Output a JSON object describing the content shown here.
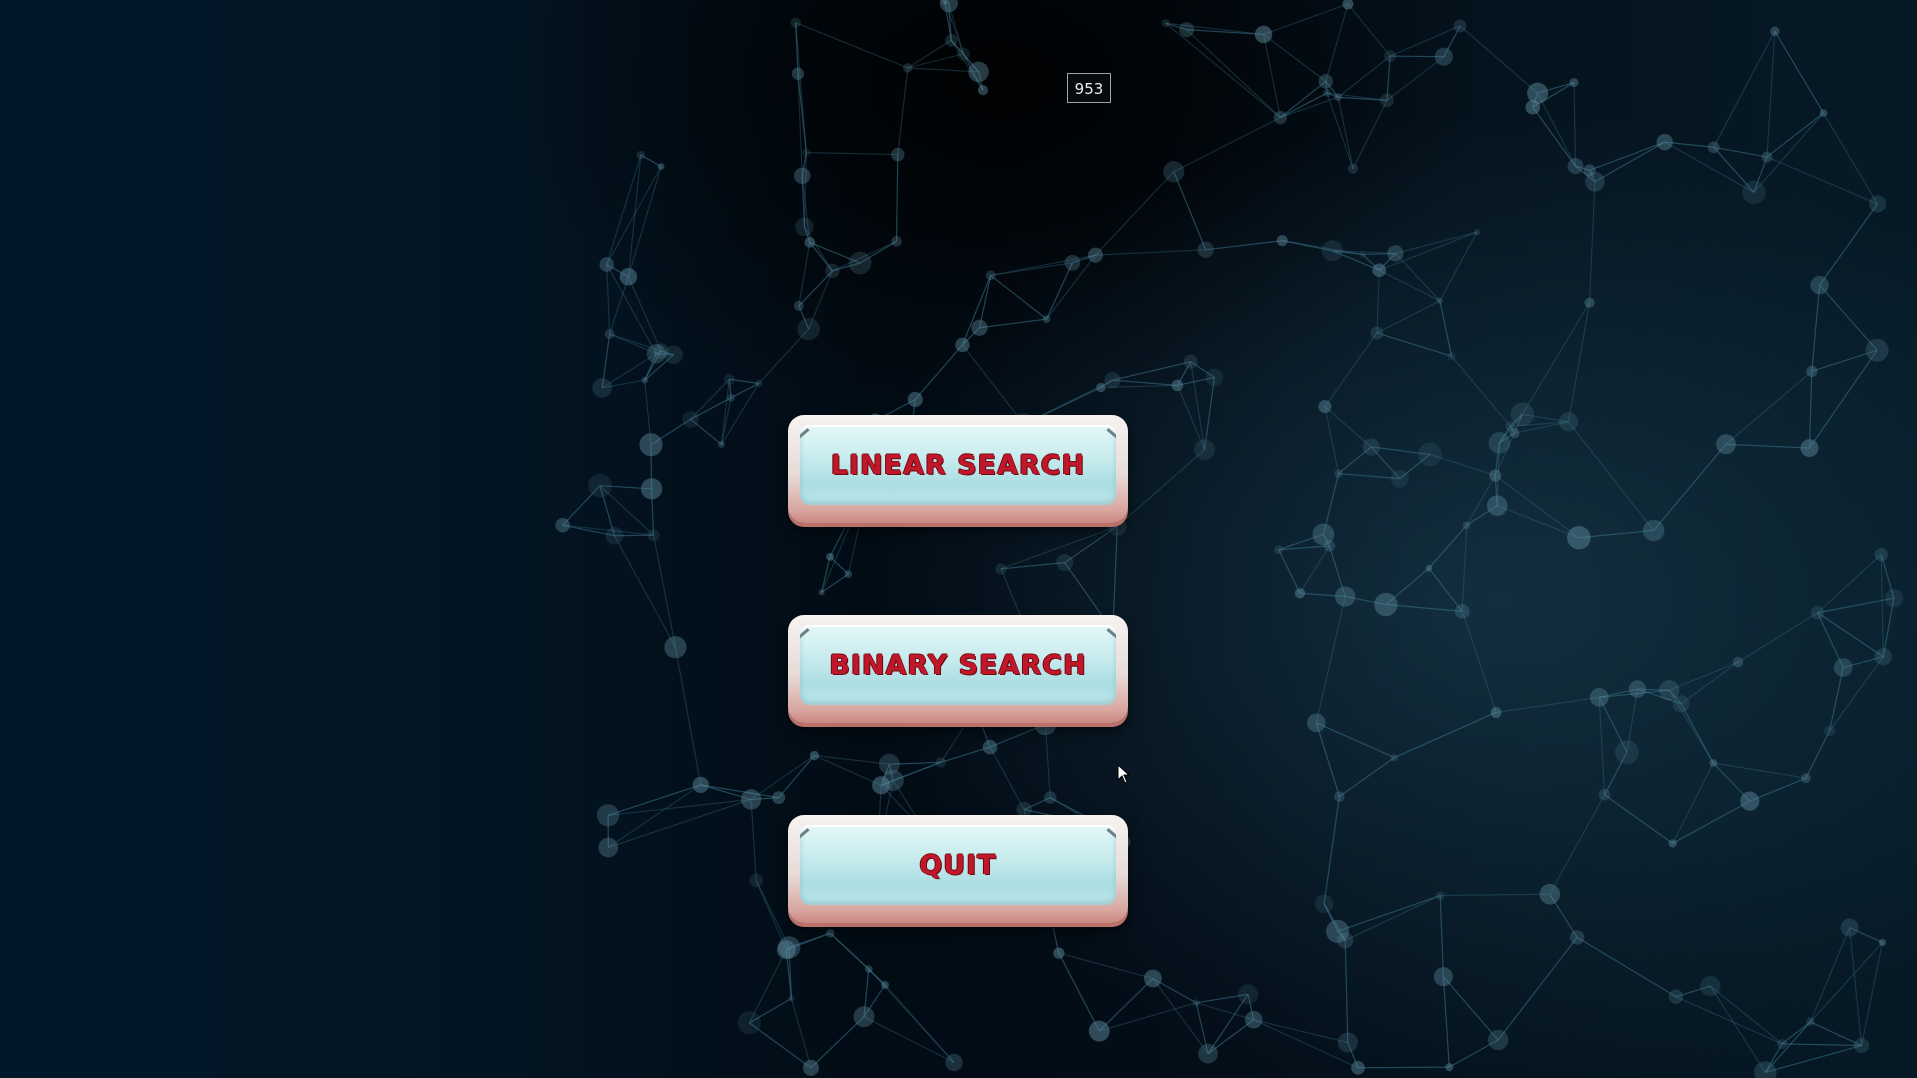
{
  "hud": {
    "counter": "953"
  },
  "menu": {
    "buttons": [
      {
        "label": "LINEAR SEARCH"
      },
      {
        "label": "BINARY SEARCH"
      },
      {
        "label": "QUIT"
      }
    ]
  },
  "colors": {
    "background": "#010f1a",
    "network_lines": "#3a6f86",
    "button_text": "#c0182a",
    "button_face": "#c9ecee",
    "button_rim": "#d9a6a0"
  },
  "icons": {
    "cursor": "mouse-pointer-icon"
  }
}
